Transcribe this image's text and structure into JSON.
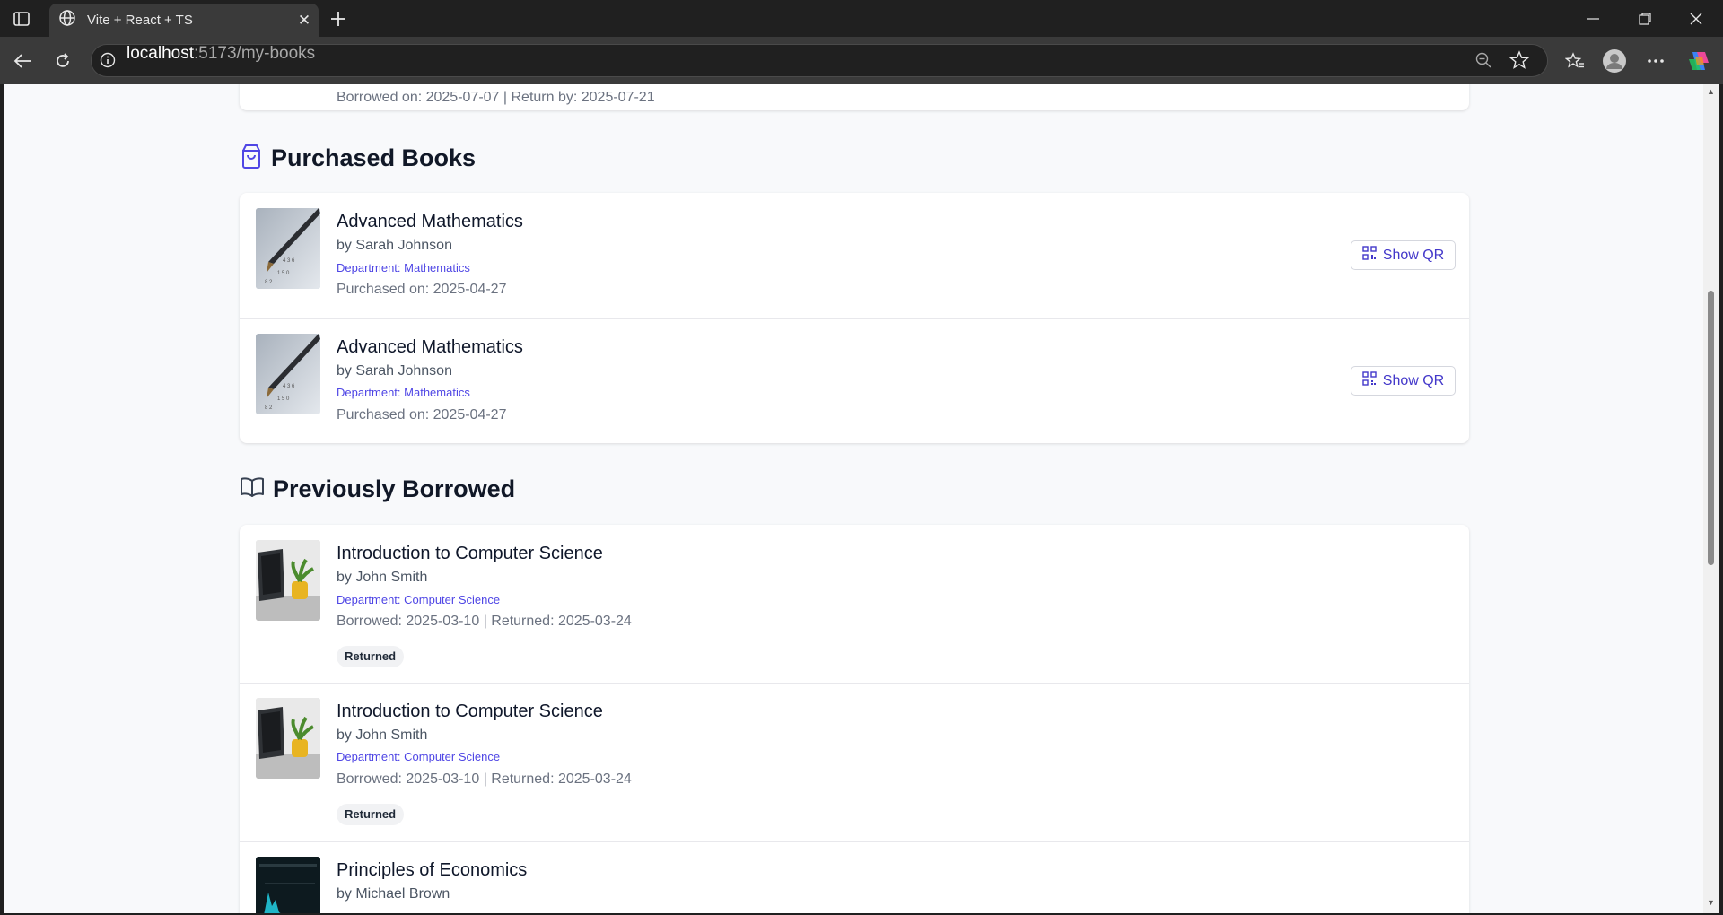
{
  "browser": {
    "tab_title": "Vite + React + TS",
    "url_host": "localhost",
    "url_rest": ":5173/my-books"
  },
  "top_partial": {
    "date_text": "Borrowed on: 2025-07-07 | Return by: 2025-07-21"
  },
  "purchased": {
    "heading": "Purchased Books",
    "button_label": "Show QR",
    "items": [
      {
        "title": "Advanced Mathematics",
        "author": "by Sarah Johnson",
        "department": "Department: Mathematics",
        "date": "Purchased on: 2025-04-27"
      },
      {
        "title": "Advanced Mathematics",
        "author": "by Sarah Johnson",
        "department": "Department: Mathematics",
        "date": "Purchased on: 2025-04-27"
      }
    ]
  },
  "previous": {
    "heading": "Previously Borrowed",
    "items": [
      {
        "title": "Introduction to Computer Science",
        "author": "by John Smith",
        "department": "Department: Computer Science",
        "date": "Borrowed: 2025-03-10 | Returned: 2025-03-24",
        "status": "Returned"
      },
      {
        "title": "Introduction to Computer Science",
        "author": "by John Smith",
        "department": "Department: Computer Science",
        "date": "Borrowed: 2025-03-10 | Returned: 2025-03-24",
        "status": "Returned"
      },
      {
        "title": "Principles of Economics",
        "author": "by Michael Brown"
      }
    ]
  },
  "colors": {
    "accent": "#4f46e5",
    "page_bg": "#f8f9fb",
    "chrome_bg": "#202020"
  }
}
